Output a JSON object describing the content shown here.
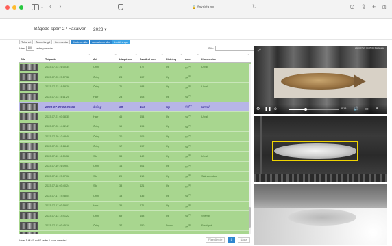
{
  "browser": {
    "address": "fiskdata.se",
    "colors": {
      "close": "#ff5f57",
      "minimize": "#febc2e",
      "zoom": "#28c840"
    }
  },
  "header": {
    "title": "Bågede spärr 2 / Faxälven",
    "year": "2023 ▾"
  },
  "toolbar": {
    "buttons": [
      "Tolka art",
      "Ändra längd",
      "Kommentar",
      "Markera alla",
      "Avmarkera alla",
      "Inställningar"
    ]
  },
  "table_controls": {
    "visa_label": "Visa",
    "page_size": "100",
    "rows_label": "rader per sida",
    "search_label": "Sök:",
    "search_value": ""
  },
  "table": {
    "columns": [
      "Bild",
      "Tidpunkt",
      "Art",
      "Längd cm",
      "Avstånd mm",
      "Riktning",
      "Anv.",
      "Kommentar"
    ],
    "rows": [
      [
        "",
        "2023-07-23 21:00:34",
        "Öring",
        "21",
        "377",
        "Up",
        "SK",
        "Urval"
      ],
      [
        "",
        "2023-07-23 23:57:32",
        "Öring",
        "23",
        "407",
        "Up",
        "SK",
        ""
      ],
      [
        "",
        "2023-07-23 16:58:29",
        "Öring",
        "71",
        "588",
        "Up",
        "SK",
        "Urval"
      ],
      [
        "",
        "2023-07-23 16:11:20",
        "Harr",
        "23",
        "403",
        "Up",
        "SK",
        ""
      ],
      [
        "",
        "2023-07-22 04:05:06",
        "Öring",
        "68",
        "440",
        "Up",
        "SK",
        "Urval"
      ],
      [
        "",
        "2023-07-21 03:08:35",
        "Harr",
        "45",
        "454",
        "Up",
        "SK",
        "Urval"
      ],
      [
        "",
        "2023-07-20 14:02:47",
        "Öring",
        "19",
        "496",
        "Up",
        "SK",
        ""
      ],
      [
        "",
        "2023-07-20 10:48:48",
        "Öring",
        "20",
        "405",
        "Up",
        "SK",
        ""
      ],
      [
        "",
        "2023-07-20 15:18:45",
        "Öring",
        "17",
        "397",
        "Up",
        "SK",
        ""
      ],
      [
        "",
        "2023-07-19 18:51:52",
        "Sik",
        "38",
        "442",
        "Up",
        "SK",
        "Urval"
      ],
      [
        "",
        "2023-07-19 21:09:07",
        "Öring",
        "14",
        "501",
        "Up",
        "SK",
        ""
      ],
      [
        "",
        "2023-07-19 23:07:08",
        "Sik",
        "29",
        "410",
        "Up",
        "SK",
        "Saknar video"
      ],
      [
        "",
        "2023-07-18 03:40:24",
        "Sik",
        "38",
        "421",
        "Up",
        "SK",
        ""
      ],
      [
        "",
        "2023-07-17 19:48:04",
        "Öring",
        "18",
        "535",
        "Up",
        "SK",
        ""
      ],
      [
        "",
        "2023-07-17 03:19:02",
        "Harr",
        "35",
        "471",
        "Up",
        "SK",
        ""
      ],
      [
        "",
        "2023-07-13 14:41:22",
        "Öring",
        "69",
        "458",
        "Up",
        "SK",
        "Svamp"
      ],
      [
        "",
        "2023-07-12 03:45:16",
        "Öring",
        "37",
        "450",
        "Down",
        "SK",
        "Fenklippt"
      ],
      [
        "",
        "2023-07-13 11:03:18",
        "Öring",
        "31",
        "451",
        "Down",
        "SK",
        ""
      ],
      [
        "",
        "2023-07-13 23:51:31",
        "Öring",
        "31",
        "502",
        "Down",
        "SK",
        ""
      ]
    ],
    "highlighted_row": 4
  },
  "footer": {
    "info": "Visar 1 till 67 av 67 rader 1 rows selected",
    "prev": "Föregående",
    "page": "1",
    "next": "Nästa"
  },
  "video": {
    "timestamp": "2023-07-22 04:05:09 fiskdata.se",
    "time": "0:15"
  }
}
